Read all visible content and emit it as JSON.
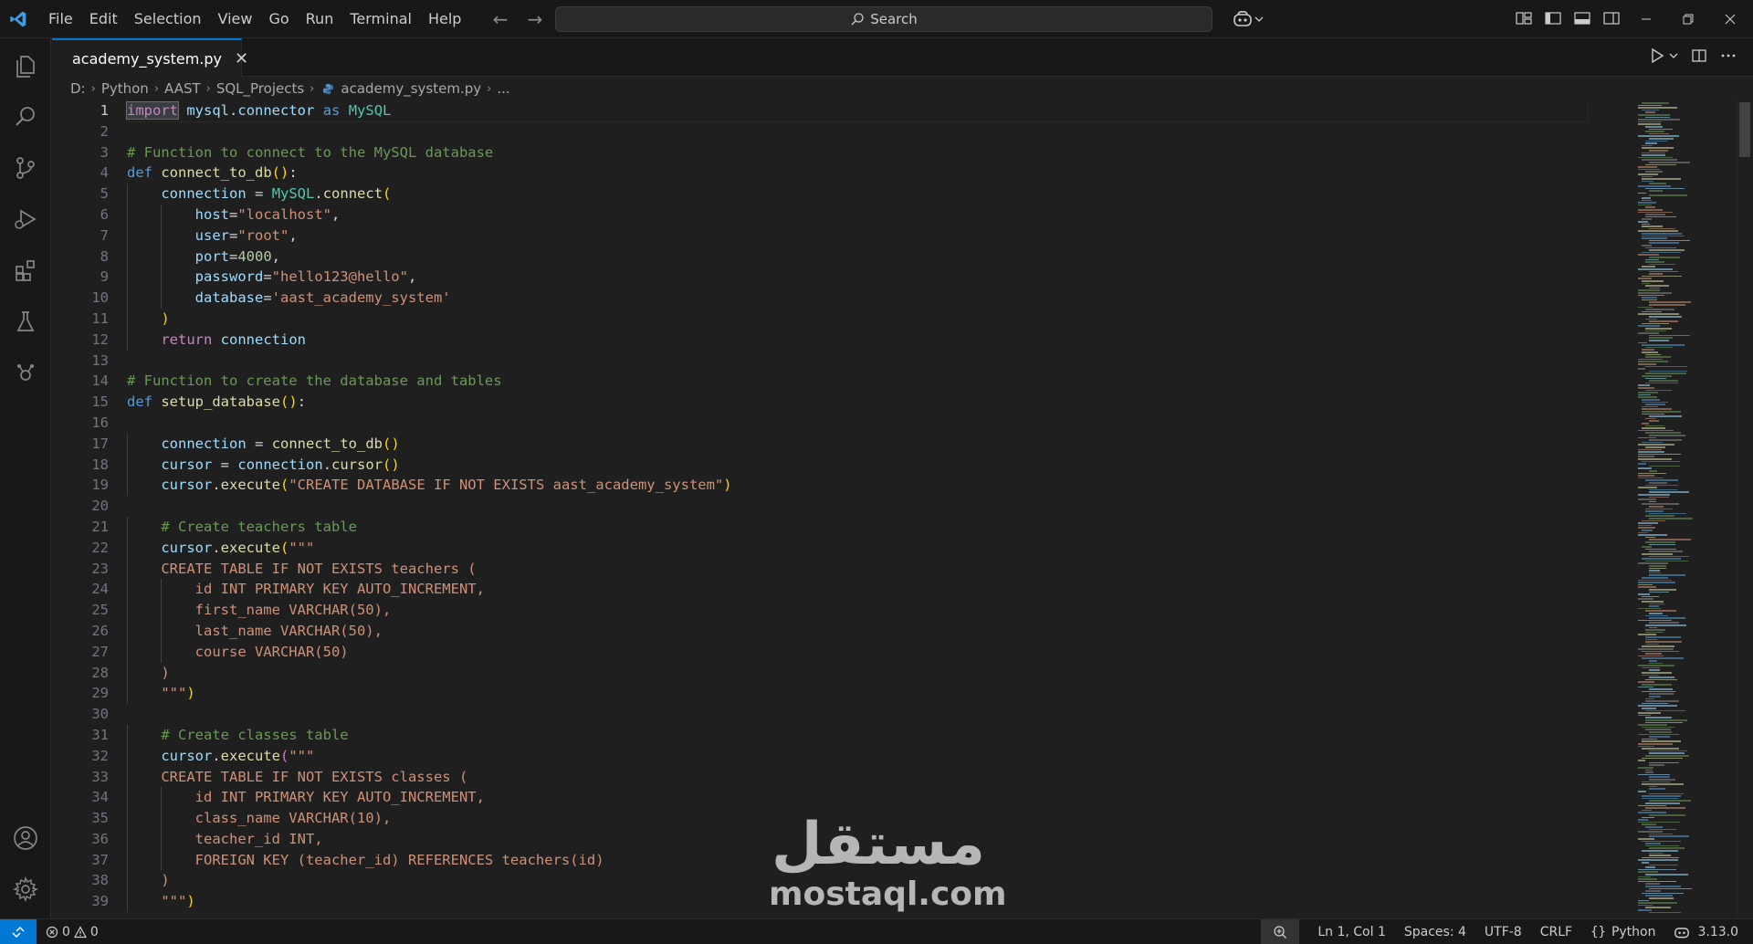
{
  "menu": [
    "File",
    "Edit",
    "Selection",
    "View",
    "Go",
    "Run",
    "Terminal",
    "Help"
  ],
  "search": {
    "label": "Search"
  },
  "tab": {
    "label": "academy_system.py",
    "close": "✕"
  },
  "breadcrumbs": [
    "D:",
    "Python",
    "AAST",
    "SQL_Projects",
    "academy_system.py",
    "..."
  ],
  "code": {
    "active_line": 1,
    "lines": [
      "import mysql.connector as MySQL",
      "",
      "# Function to connect to the MySQL database",
      "def connect_to_db():",
      "    connection = MySQL.connect(",
      "        host=\"localhost\",",
      "        user=\"root\",",
      "        port=4000,",
      "        password=\"hello123@hello\",",
      "        database='aast_academy_system'",
      "    )",
      "    return connection",
      "",
      "# Function to create the database and tables",
      "def setup_database():",
      "",
      "    connection = connect_to_db()",
      "    cursor = connection.cursor()",
      "    cursor.execute(\"CREATE DATABASE IF NOT EXISTS aast_academy_system\")",
      "",
      "    # Create teachers table",
      "    cursor.execute(\"\"\"",
      "    CREATE TABLE IF NOT EXISTS teachers (",
      "        id INT PRIMARY KEY AUTO_INCREMENT,",
      "        first_name VARCHAR(50),",
      "        last_name VARCHAR(50),",
      "        course VARCHAR(50)",
      "    )",
      "    \"\"\")",
      "",
      "    # Create classes table",
      "    cursor.execute(\"\"\"",
      "    CREATE TABLE IF NOT EXISTS classes (",
      "        id INT PRIMARY KEY AUTO_INCREMENT,",
      "        class_name VARCHAR(10),",
      "        teacher_id INT,",
      "        FOREIGN KEY (teacher_id) REFERENCES teachers(id)",
      "    )",
      "    \"\"\")"
    ]
  },
  "statusbar": {
    "errors": "0",
    "warnings": "0",
    "position": "Ln 1, Col 1",
    "spaces": "Spaces: 4",
    "encoding": "UTF-8",
    "eol": "CRLF",
    "language": "Python",
    "version": "3.13.0"
  },
  "watermark": {
    "arabic": "مستقل",
    "latin": "mostaql.com"
  },
  "colors": {
    "accent": "#0078d4",
    "background": "#1f1f1f",
    "chrome": "#181818"
  }
}
